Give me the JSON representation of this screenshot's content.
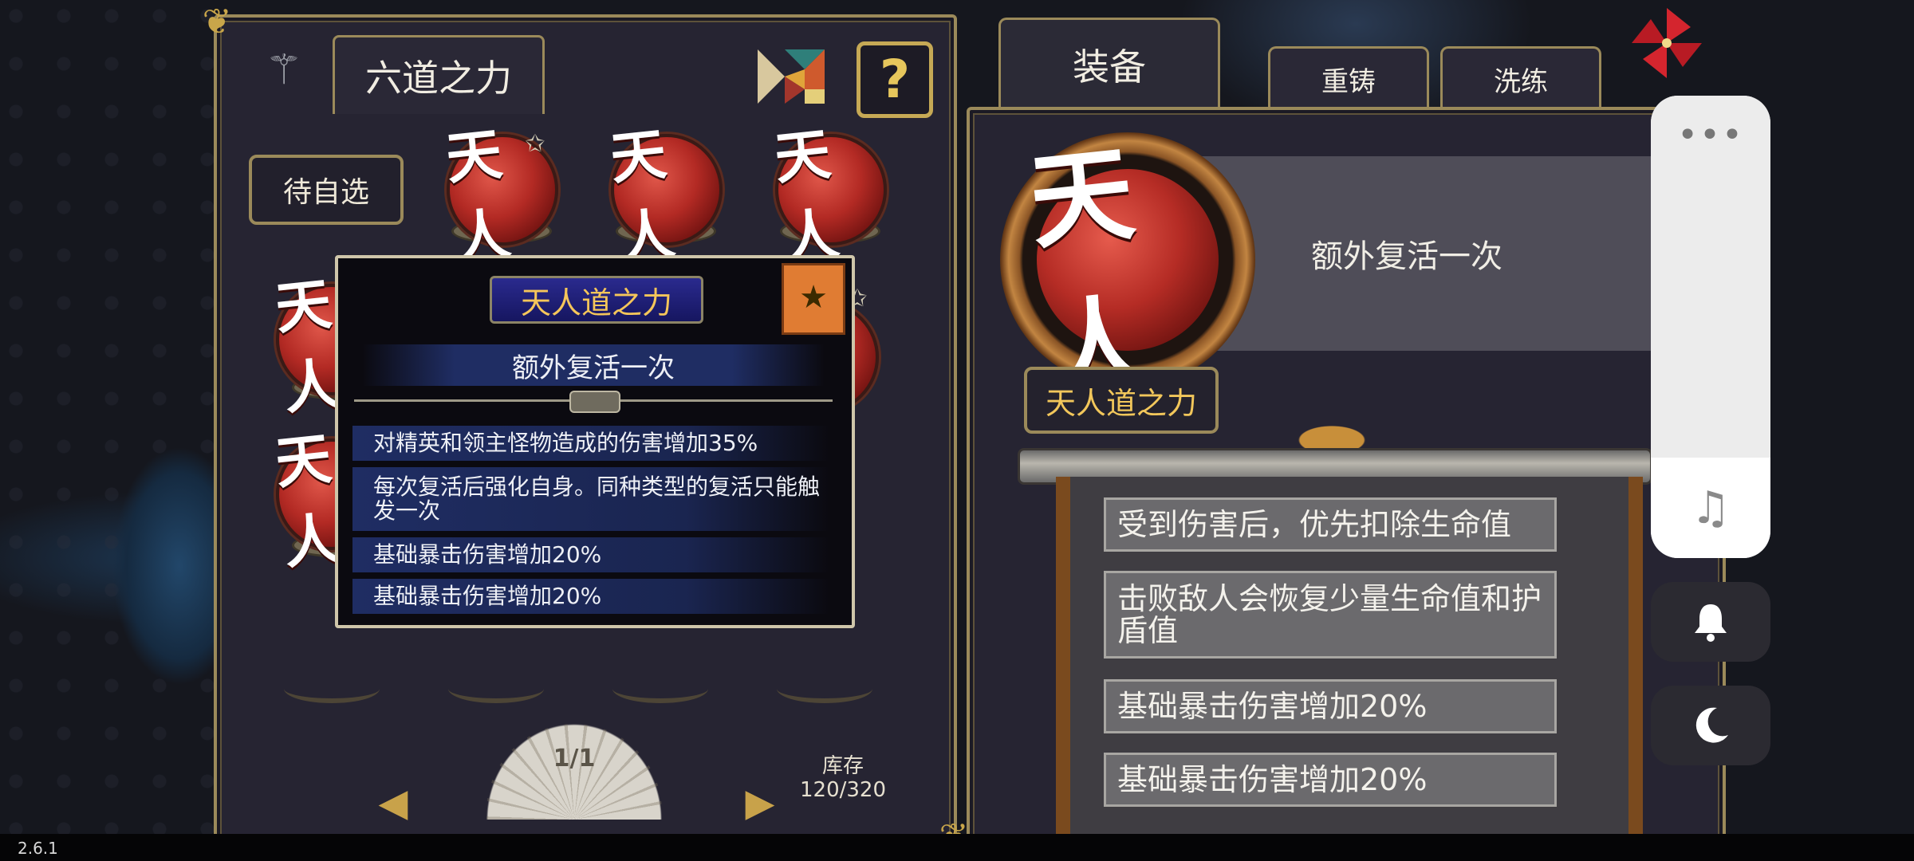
{
  "left_panel": {
    "title": "六道之力",
    "slot_label": "待自选",
    "page": "1/1",
    "inventory_label": "库存",
    "inventory_value": "120/320"
  },
  "tooltip": {
    "title": "天人道之力",
    "description": "额外复活一次",
    "rows": [
      "对精英和领主怪物造成的伤害增加35%",
      "每次复活后强化自身。同种类型的复活只能触发一次",
      "基础暴击伤害增加20%",
      "基础暴击伤害增加20%"
    ]
  },
  "orb_glyph": "天人",
  "tabs": {
    "equip": "装备",
    "recast": "重铸",
    "refine": "洗练"
  },
  "detail": {
    "description": "额外复活一次",
    "name": "天人道之力",
    "effects": [
      "受到伤害后，优先扣除生命值",
      "击败敌人会恢复少量生命值和护盾值",
      "基础暴击伤害增加20%",
      "基础暴击伤害增加20%"
    ]
  },
  "overlay": {
    "more_icon": "more-dots-icon",
    "music_icon": "music-note-icon",
    "bell_icon": "bell-icon",
    "moon_icon": "moon-icon"
  },
  "version": "2.6.1",
  "colors": {
    "panel_bg": "#262432",
    "gold_border": "#9b8a5a",
    "orb_red": "#b32a24",
    "tooltip_title_gold": "#f5c65a",
    "tooltip_row_blue": "#1f2d63"
  }
}
